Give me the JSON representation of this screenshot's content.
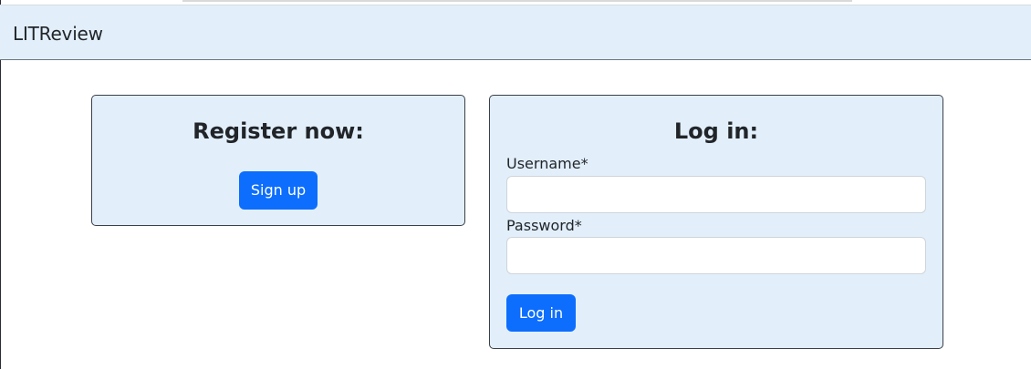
{
  "navbar": {
    "brand": "LITReview"
  },
  "register": {
    "title": "Register now:",
    "signup_label": "Sign up"
  },
  "login": {
    "title": "Log in:",
    "username_label": "Username*",
    "username_value": "",
    "password_label": "Password*",
    "password_value": "",
    "submit_label": "Log in"
  },
  "colors": {
    "accent": "#0d6efd",
    "card_background": "#e2effb",
    "navbar_background": "#e2effb"
  }
}
